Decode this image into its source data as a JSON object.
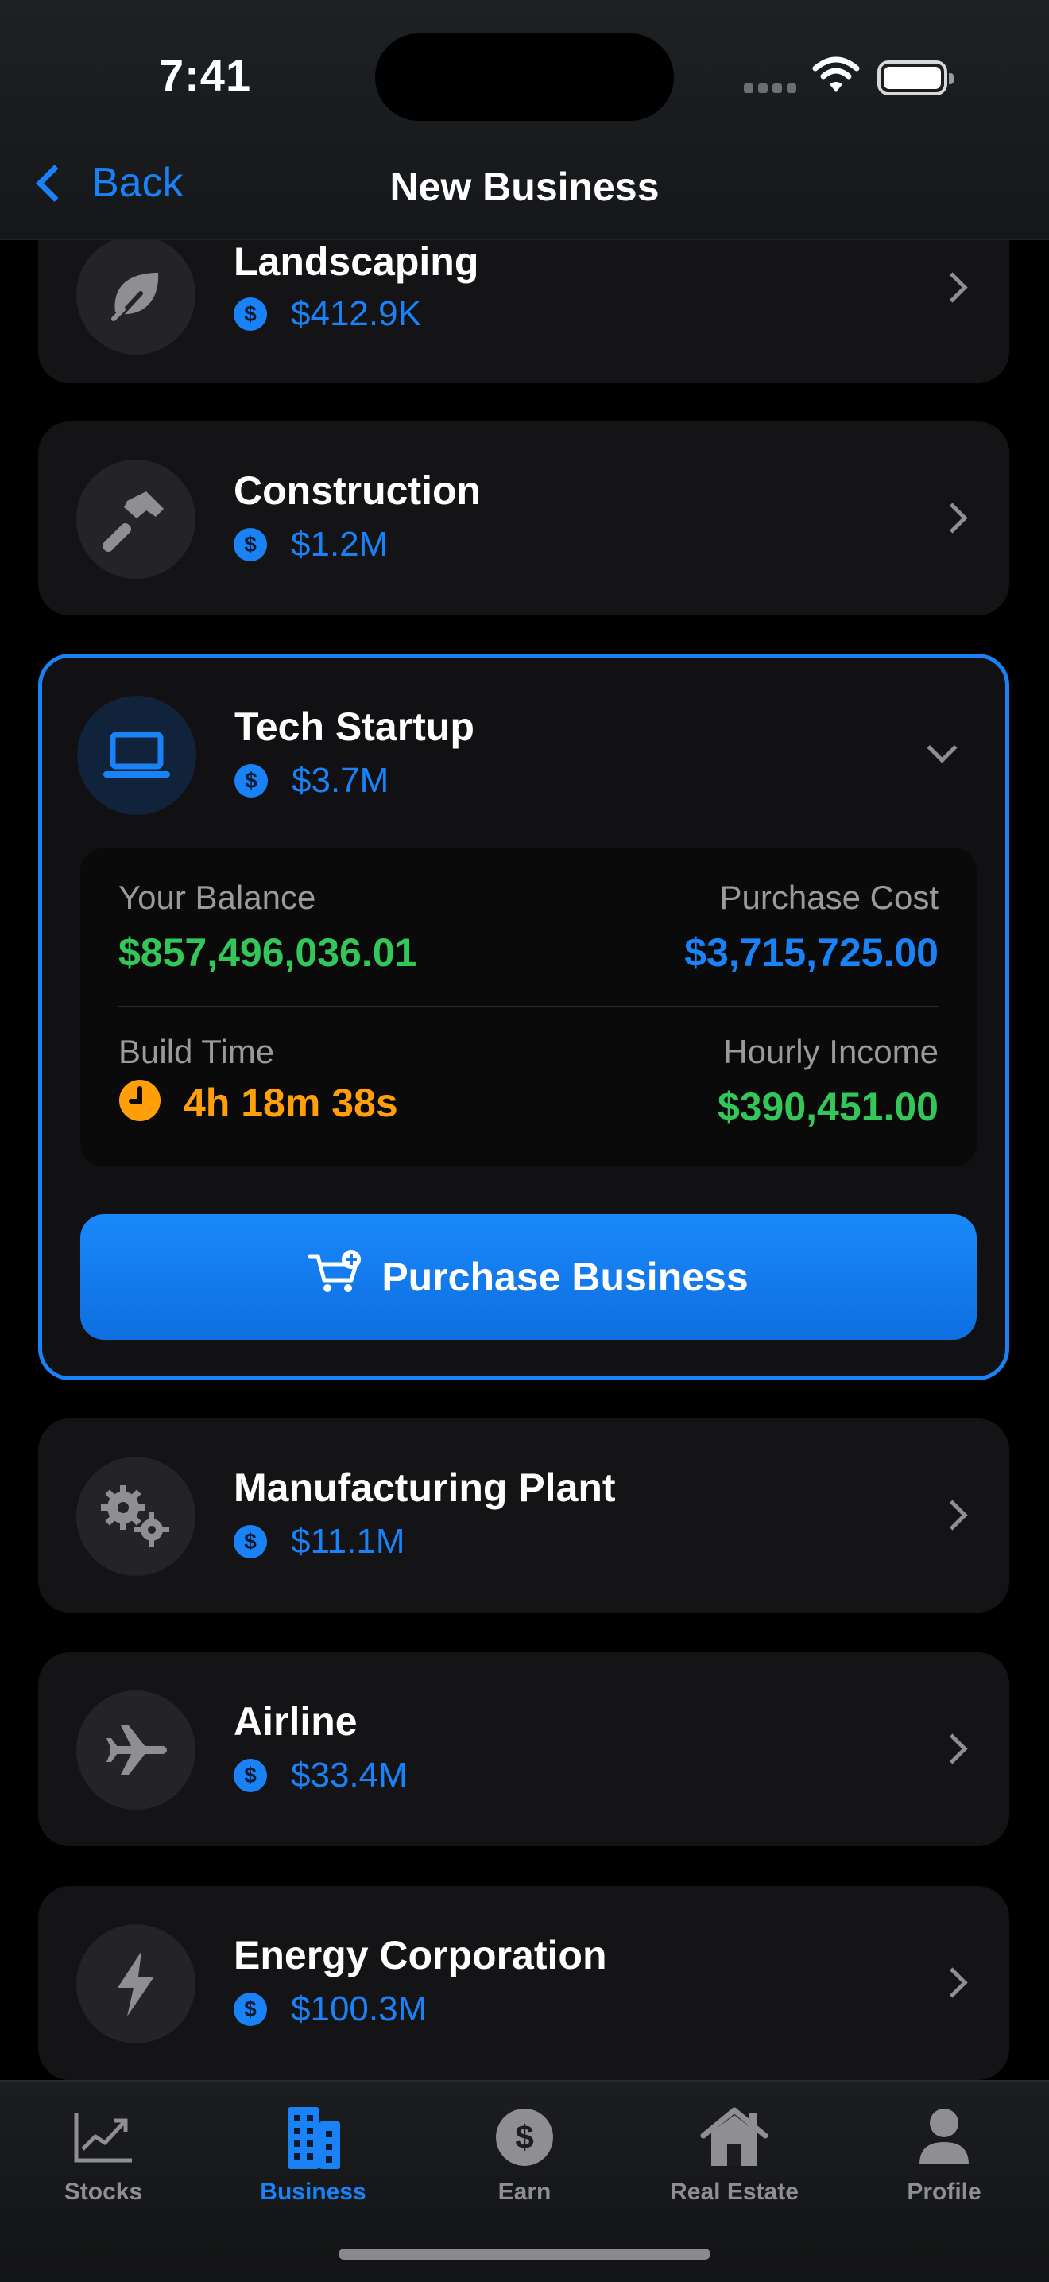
{
  "status": {
    "time": "7:41"
  },
  "nav": {
    "back_label": "Back",
    "title": "New Business"
  },
  "businesses": [
    {
      "name": "Landscaping",
      "price": "$412.9K",
      "icon": "leaf-icon"
    },
    {
      "name": "Construction",
      "price": "$1.2M",
      "icon": "hammer-icon"
    },
    {
      "name": "Tech Startup",
      "price": "$3.7M",
      "icon": "laptop-icon"
    },
    {
      "name": "Manufacturing Plant",
      "price": "$11.1M",
      "icon": "gears-icon"
    },
    {
      "name": "Airline",
      "price": "$33.4M",
      "icon": "airplane-icon"
    },
    {
      "name": "Energy Corporation",
      "price": "$100.3M",
      "icon": "bolt-icon"
    }
  ],
  "coin_symbol": "$",
  "details": {
    "balance_label": "Your Balance",
    "balance_value": "$857,496,036.01",
    "cost_label": "Purchase Cost",
    "cost_value": "$3,715,725.00",
    "build_label": "Build Time",
    "build_value": "4h 18m 38s",
    "income_label": "Hourly Income",
    "income_value": "$390,451.00",
    "purchase_button": "Purchase Business"
  },
  "tabs": [
    {
      "label": "Stocks",
      "icon": "chart-icon"
    },
    {
      "label": "Business",
      "icon": "building-icon",
      "active": true
    },
    {
      "label": "Earn",
      "icon": "dollar-circle-icon"
    },
    {
      "label": "Real Estate",
      "icon": "house-icon"
    },
    {
      "label": "Profile",
      "icon": "person-icon"
    }
  ],
  "colors": {
    "accent": "#1a82f7",
    "green": "#33c759",
    "orange": "#ff9f0a",
    "card": "#141416"
  }
}
